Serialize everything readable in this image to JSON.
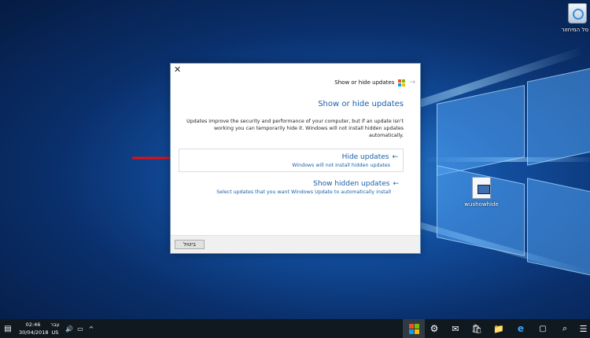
{
  "desktop": {
    "recycle_bin_label": "סל המיחזור",
    "file_icon_label": "wushowhide"
  },
  "dialog": {
    "window_title": "Show or hide updates",
    "close_glyph": "✕",
    "back_glyph": "→",
    "heading": "Show or hide updates",
    "description": "Updates improve the security and performance of your computer, but if an update isn't working you can temporarily hide it. Windows will not install hidden updates automatically.",
    "options": [
      {
        "title": "Hide updates",
        "arrow": "←",
        "subtitle": "Windows will not install hidden updates"
      },
      {
        "title": "Show hidden updates",
        "arrow": "←",
        "subtitle": "Select updates that you want Windows Update to automatically install"
      }
    ],
    "cancel_label": "ביטול"
  },
  "taskbar": {
    "time": "02:46",
    "date": "30/04/2018",
    "lang_line1": "עבר",
    "lang_line2": "US",
    "icons": {
      "start": "windows-logo-icon",
      "settings": "⚙",
      "mail": "✉",
      "store": "🛍",
      "explorer": "📁",
      "edge": "e",
      "task_view": "▢",
      "search": "⌕",
      "menu": "☰",
      "notifications": "▤",
      "volume": "🔊",
      "network": "▭",
      "chevron": "^"
    }
  },
  "colors": {
    "ms_red": "#f25022",
    "ms_green": "#7fba00",
    "ms_blue": "#00a4ef",
    "ms_yellow": "#ffb900",
    "link_blue": "#1b5fa8",
    "arrow_red": "#e01010"
  }
}
